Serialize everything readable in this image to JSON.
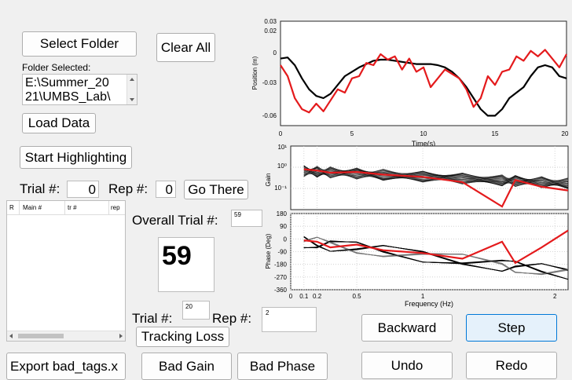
{
  "left": {
    "select_folder": "Select Folder",
    "clear_all": "Clear All",
    "folder_selected_label": "Folder Selected:",
    "folder_path_line1": "E:\\Summer_20",
    "folder_path_line2": "21\\UMBS_Lab\\",
    "load_data": "Load Data",
    "start_highlighting": "Start Highlighting",
    "trial_label": "Trial #:",
    "trial_value": "0",
    "rep_label": "Rep #:",
    "rep_value": "0",
    "go_there": "Go There",
    "table_headers": [
      "R",
      "Main #",
      "tr #",
      "rep"
    ]
  },
  "middle": {
    "overall_trial_label": "Overall Trial #:",
    "overall_trial_value": "59",
    "big_trial_number": "59",
    "trial_label": "Trial #:",
    "trial_value": "20",
    "rep_label": "Rep #:",
    "rep_value": "2",
    "tracking_loss": "Tracking Loss"
  },
  "bottom": {
    "export": "Export bad_tags.x",
    "bad_gain": "Bad Gain",
    "bad_phase": "Bad Phase",
    "backward": "Backward",
    "step": "Step",
    "undo": "Undo",
    "redo": "Redo"
  },
  "colors": {
    "subject_trace": "#e41a1c",
    "target_trace": "#000000",
    "selected_button": "#e5f1fb"
  },
  "chart_data": [
    {
      "type": "line",
      "xlabel": "Time(s)",
      "ylabel": "Position (m)",
      "xlim": [
        0,
        20
      ],
      "ylim": [
        -0.065,
        0.03
      ],
      "x_ticks": [
        "0",
        "5",
        "10",
        "15",
        "20"
      ],
      "y_ticks": [
        "0.03",
        "0.02",
        "0",
        "-0.03",
        "-0.06"
      ],
      "series": [
        {
          "color": "#000000",
          "x": [
            0,
            0.5,
            1,
            1.5,
            2,
            2.5,
            3,
            3.5,
            4,
            4.5,
            5,
            5.5,
            6,
            6.5,
            7,
            7.5,
            8,
            8.5,
            9,
            9.5,
            10,
            10.5,
            11,
            11.5,
            12,
            12.5,
            13,
            13.5,
            14,
            14.5,
            15,
            15.5,
            16,
            16.5,
            17,
            17.5,
            18,
            18.5,
            19,
            19.5,
            20
          ],
          "values": [
            -0.004,
            -0.003,
            -0.01,
            -0.022,
            -0.032,
            -0.038,
            -0.04,
            -0.036,
            -0.028,
            -0.02,
            -0.016,
            -0.012,
            -0.009,
            -0.006,
            -0.005,
            -0.005,
            -0.006,
            -0.007,
            -0.008,
            -0.009,
            -0.009,
            -0.009,
            -0.01,
            -0.012,
            -0.016,
            -0.022,
            -0.03,
            -0.04,
            -0.05,
            -0.056,
            -0.056,
            -0.05,
            -0.04,
            -0.035,
            -0.03,
            -0.02,
            -0.012,
            -0.01,
            -0.012,
            -0.02,
            -0.022
          ]
        },
        {
          "color": "#e41a1c",
          "x": [
            0,
            0.5,
            1,
            1.5,
            2,
            2.5,
            3,
            3.5,
            4,
            4.5,
            5,
            5.5,
            6,
            6.5,
            7,
            7.5,
            8,
            8.5,
            9,
            9.5,
            10,
            10.5,
            11,
            11.5,
            12,
            12.5,
            13,
            13.5,
            14,
            14.5,
            15,
            15.5,
            16,
            16.5,
            17,
            17.5,
            18,
            18.5,
            19,
            19.5,
            20
          ],
          "values": [
            -0.01,
            -0.02,
            -0.04,
            -0.05,
            -0.053,
            -0.045,
            -0.052,
            -0.042,
            -0.032,
            -0.035,
            -0.022,
            -0.02,
            -0.008,
            -0.01,
            0.0,
            -0.005,
            -0.002,
            -0.014,
            -0.004,
            -0.016,
            -0.012,
            -0.03,
            -0.022,
            -0.014,
            -0.018,
            -0.022,
            -0.032,
            -0.048,
            -0.04,
            -0.02,
            -0.028,
            -0.016,
            -0.014,
            -0.002,
            -0.006,
            0.003,
            -0.002,
            0.004,
            -0.004,
            -0.012,
            0.0
          ]
        }
      ]
    },
    {
      "type": "line",
      "xlabel": "",
      "ylabel": "Gain",
      "y_scale": "log",
      "ylim": [
        0.01,
        10
      ],
      "xlim": [
        0,
        2.1
      ],
      "y_ticks": [
        "10¹",
        "10⁰",
        "10⁻¹"
      ],
      "grid": true,
      "series": [
        {
          "color": "#e41a1c",
          "x": [
            0.1,
            0.2,
            0.3,
            0.5,
            0.7,
            1.0,
            1.3,
            1.6,
            1.7,
            1.9,
            2.1
          ],
          "values": [
            0.8,
            0.7,
            0.55,
            0.6,
            0.45,
            0.35,
            0.2,
            0.014,
            0.25,
            0.12,
            0.08
          ]
        }
      ]
    },
    {
      "type": "line",
      "xlabel": "Frequency (Hz)",
      "ylabel": "Phase (Deg)",
      "xlim": [
        0,
        2.1
      ],
      "ylim": [
        -360,
        180
      ],
      "x_ticks": [
        "0",
        "0.1",
        "0.2",
        "0.5",
        "1",
        "2"
      ],
      "y_ticks": [
        "180",
        "90",
        "0",
        "-90",
        "-180",
        "-270",
        "-360"
      ],
      "series": [
        {
          "color": "#e41a1c",
          "x": [
            0.1,
            0.2,
            0.3,
            0.5,
            0.7,
            1.0,
            1.3,
            1.6,
            1.7,
            1.9,
            2.1
          ],
          "values": [
            -10,
            -20,
            -60,
            -40,
            -80,
            -100,
            -140,
            -20,
            -170,
            -60,
            60
          ]
        }
      ]
    }
  ]
}
